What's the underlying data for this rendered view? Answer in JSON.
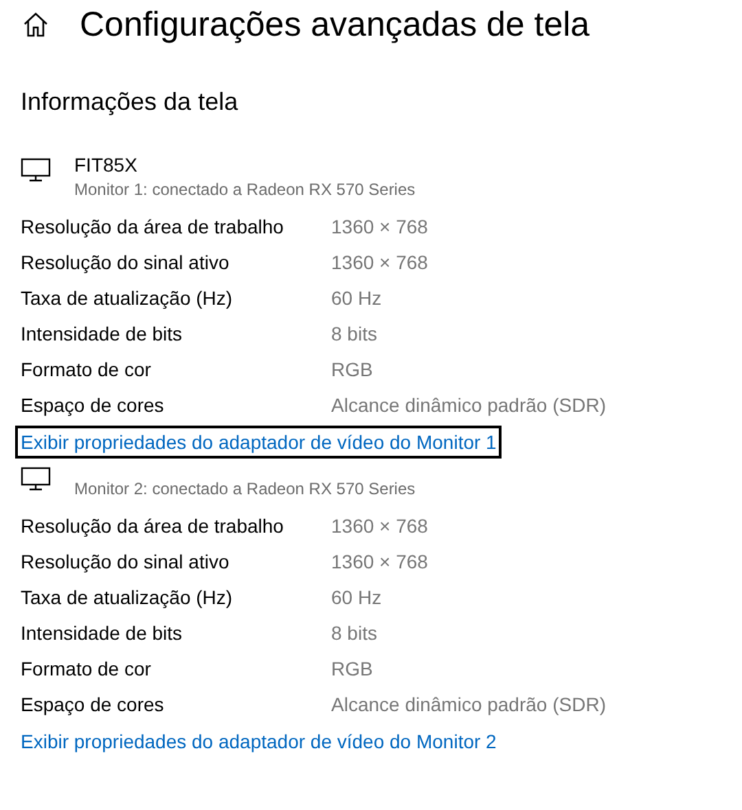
{
  "page_title": "Configurações avançadas de tela",
  "section_title": "Informações da tela",
  "monitors": [
    {
      "name": "FIT85X",
      "subtitle": "Monitor 1: conectado a Radeon RX 570 Series",
      "details": [
        {
          "label": "Resolução da área de trabalho",
          "value": "1360 × 768"
        },
        {
          "label": "Resolução do sinal ativo",
          "value": "1360 × 768"
        },
        {
          "label": "Taxa de atualização (Hz)",
          "value": "60 Hz"
        },
        {
          "label": "Intensidade de bits",
          "value": "8 bits"
        },
        {
          "label": "Formato de cor",
          "value": "RGB"
        },
        {
          "label": "Espaço de cores",
          "value": "Alcance dinâmico padrão (SDR)"
        }
      ],
      "link": {
        "text": "Exibir propriedades do adaptador de vídeo do Monitor 1",
        "focused": true
      }
    },
    {
      "subtitle": "Monitor 2: conectado a Radeon RX 570 Series",
      "details": [
        {
          "label": "Resolução da área de trabalho",
          "value": "1360 × 768"
        },
        {
          "label": "Resolução do sinal ativo",
          "value": "1360 × 768"
        },
        {
          "label": "Taxa de atualização (Hz)",
          "value": "60 Hz"
        },
        {
          "label": "Intensidade de bits",
          "value": "8 bits"
        },
        {
          "label": "Formato de cor",
          "value": "RGB"
        },
        {
          "label": "Espaço de cores",
          "value": "Alcance dinâmico padrão (SDR)"
        }
      ],
      "link": {
        "text": "Exibir propriedades do adaptador de vídeo do Monitor 2",
        "focused": false
      }
    }
  ]
}
